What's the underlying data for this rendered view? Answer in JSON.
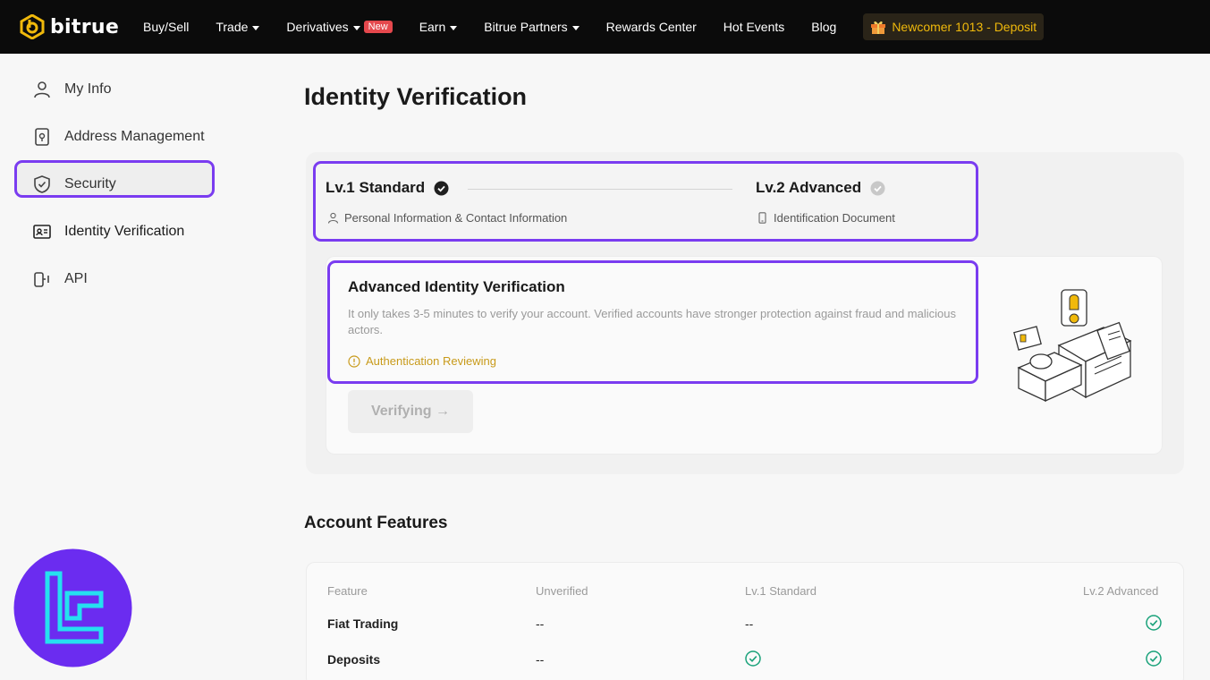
{
  "brand": {
    "name": "bitrue"
  },
  "nav": {
    "items": [
      {
        "label": "Buy/Sell",
        "caret": false
      },
      {
        "label": "Trade",
        "caret": true
      },
      {
        "label": "Derivatives",
        "caret": true,
        "badge": "New"
      },
      {
        "label": "Earn",
        "caret": true
      },
      {
        "label": "Bitrue Partners",
        "caret": true
      },
      {
        "label": "Rewards Center",
        "caret": false
      },
      {
        "label": "Hot Events",
        "caret": false
      },
      {
        "label": "Blog",
        "caret": false
      }
    ],
    "promo": "Newcomer 1013 - Deposit"
  },
  "sidebar": {
    "items": [
      {
        "label": "My Info",
        "icon": "user-icon"
      },
      {
        "label": "Address Management",
        "icon": "address-icon"
      },
      {
        "label": "Security",
        "icon": "shield-icon"
      },
      {
        "label": "Identity Verification",
        "icon": "id-card-icon",
        "active": true
      },
      {
        "label": "API",
        "icon": "api-icon"
      }
    ]
  },
  "page": {
    "title": "Identity Verification"
  },
  "levels": {
    "lv1": {
      "title": "Lv.1 Standard",
      "subtitle": "Personal Information & Contact Information"
    },
    "lv2": {
      "title": "Lv.2 Advanced",
      "subtitle": "Identification Document"
    }
  },
  "advanced": {
    "title": "Advanced Identity Verification",
    "description": "It only takes 3-5 minutes to verify your account. Verified accounts have stronger protection against fraud and malicious actors.",
    "status": "Authentication Reviewing",
    "button": "Verifying →"
  },
  "features": {
    "title": "Account Features",
    "headers": [
      "Feature",
      "Unverified",
      "Lv.1 Standard",
      "Lv.2 Advanced"
    ],
    "rows": [
      {
        "label": "Fiat Trading",
        "unverified": "--",
        "lv1": "--",
        "lv2": "check"
      },
      {
        "label": "Deposits",
        "unverified": "--",
        "lv1": "check",
        "lv2": "check"
      }
    ]
  },
  "colors": {
    "accent": "#7a3cf0",
    "gold": "#f0b90b",
    "success": "#1aa27a",
    "warning": "#c89a1a"
  }
}
